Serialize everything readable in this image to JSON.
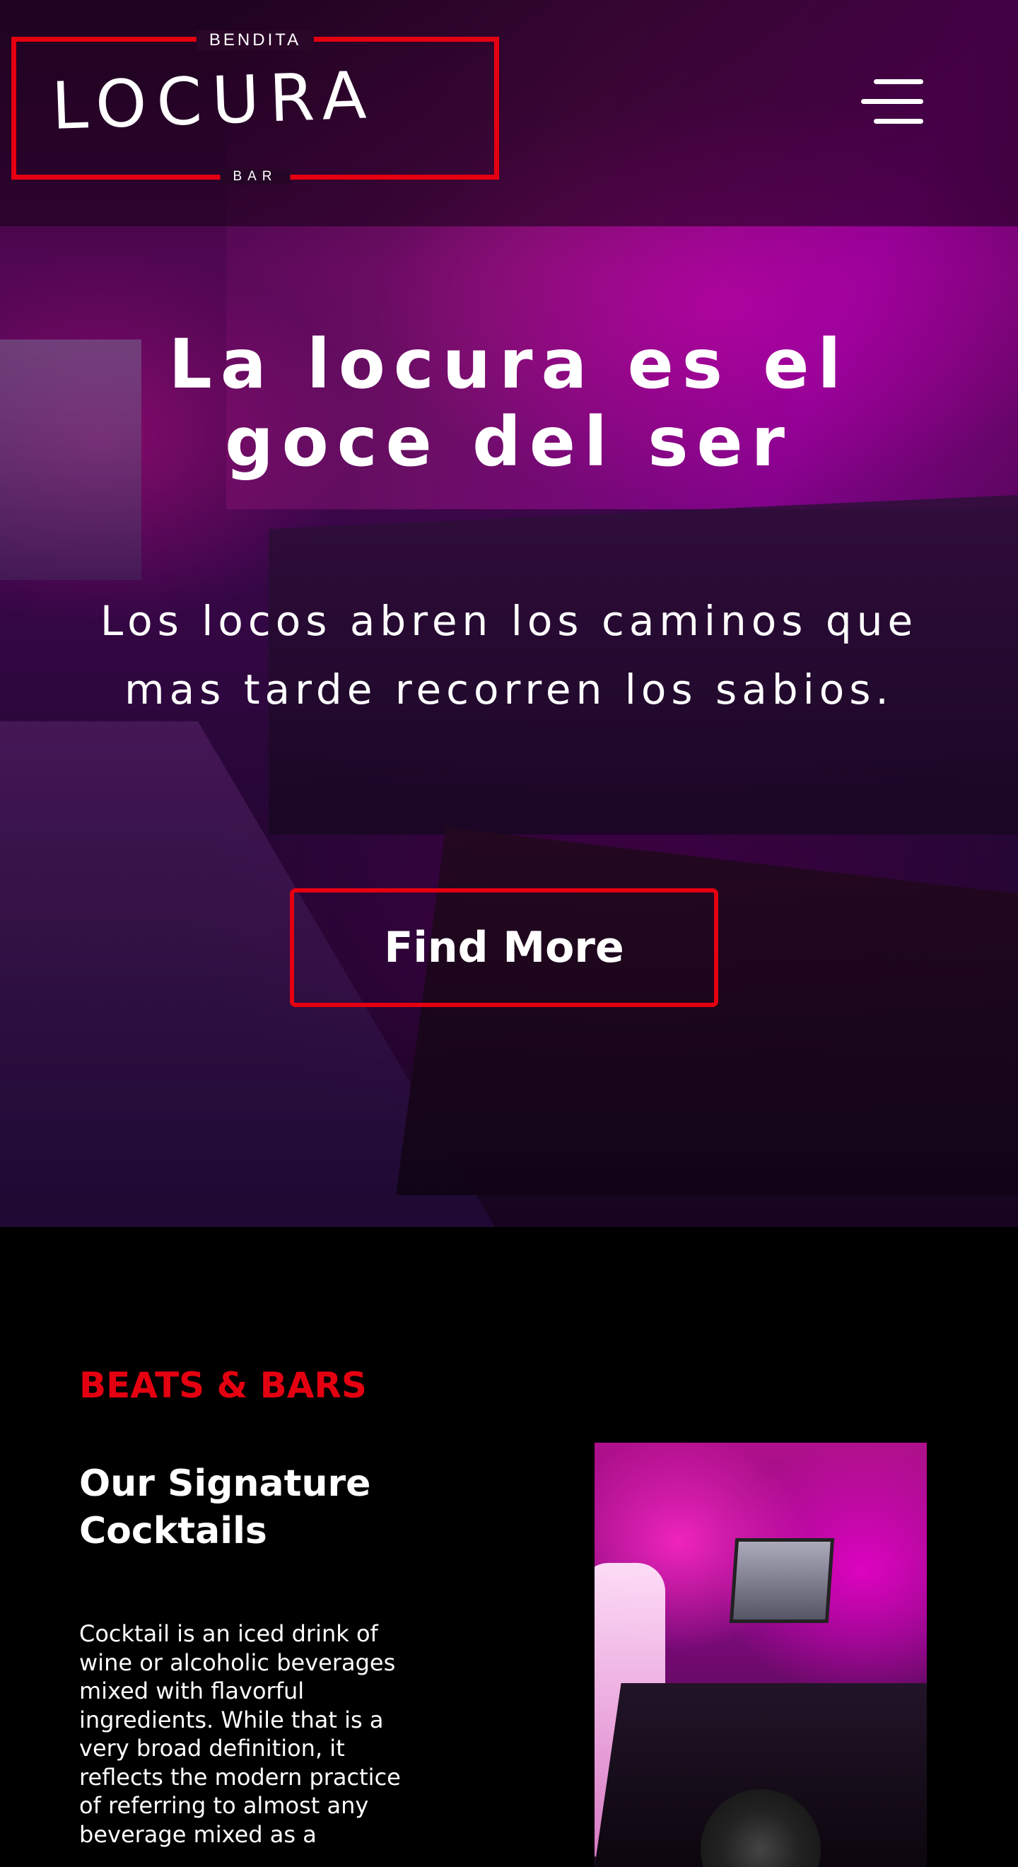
{
  "header": {
    "logo": {
      "top_text": "BENDITA",
      "main_text": "LOCURA",
      "bottom_text": "BAR"
    },
    "menu_icon": "hamburger-menu-icon"
  },
  "hero": {
    "title": "La locura es el goce del ser",
    "quote": "Los locos abren los caminos que mas tarde recorren los sabios.",
    "cta_label": "Find More"
  },
  "section": {
    "eyebrow": "BEATS & BARS",
    "title": "Our Signature Cocktails",
    "body": "Cocktail is an iced drink of wine or alcoholic beverages mixed with flavorful ingredients. While that is a very broad definition, it reflects the modern practice of referring to almost any beverage mixed as a"
  },
  "colors": {
    "accent_red": "#e40010",
    "background": "#000000",
    "text": "#ffffff"
  }
}
